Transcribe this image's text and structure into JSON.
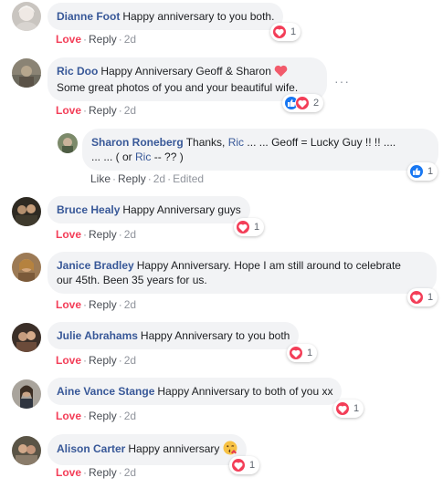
{
  "colors": {
    "author": "#385898",
    "love": "#f33e58",
    "like": "#1877f2",
    "bubble": "#f2f3f5"
  },
  "comments": [
    {
      "author": "Dianne Foot",
      "text": "Happy anniversary to you both.",
      "reaction_label": "Love",
      "reply_label": "Reply",
      "time": "2d",
      "reaction_count": "1",
      "reaction_icons": [
        "heart-icon"
      ]
    },
    {
      "author": "Ric Doo",
      "text_line1": "Happy Anniversary Geoff & Sharon",
      "text_line2": "Some great photos of you and your beautiful wife.",
      "reaction_label": "Love",
      "reply_label": "Reply",
      "time": "2d",
      "reaction_count": "2",
      "reaction_icons": [
        "like-icon",
        "heart-icon"
      ],
      "more_label": "···",
      "reply": {
        "author": "Sharon Roneberg",
        "text_a": "Thanks,",
        "mention_1": "Ric",
        "text_b": "... ... Geoff = Lucky Guy !! !! ....",
        "text_c": "... ... ( or",
        "mention_2": "Ric",
        "text_d": "-- ?? )",
        "reaction_label": "Like",
        "reply_label": "Reply",
        "time": "2d",
        "edited_label": "Edited",
        "reaction_count": "1",
        "reaction_icons": [
          "like-icon"
        ]
      }
    },
    {
      "author": "Bruce Healy",
      "text": "Happy Anniversary guys",
      "reaction_label": "Love",
      "reply_label": "Reply",
      "time": "2d",
      "reaction_count": "1",
      "reaction_icons": [
        "heart-icon"
      ]
    },
    {
      "author": "Janice Bradley",
      "text_line1": "Happy Anniversary. Hope I am still around to celebrate",
      "text_line2": "our 45th. Been 35 years for us.",
      "reaction_label": "Love",
      "reply_label": "Reply",
      "time": "2d",
      "reaction_count": "1",
      "reaction_icons": [
        "heart-icon"
      ]
    },
    {
      "author": "Julie Abrahams",
      "text": "Happy Anniversary to you both",
      "reaction_label": "Love",
      "reply_label": "Reply",
      "time": "2d",
      "reaction_count": "1",
      "reaction_icons": [
        "heart-icon"
      ]
    },
    {
      "author": "Aine Vance Stange",
      "text": "Happy Anniversary to both of you xx",
      "reaction_label": "Love",
      "reply_label": "Reply",
      "time": "2d",
      "reaction_count": "1",
      "reaction_icons": [
        "heart-icon"
      ]
    },
    {
      "author": "Alison Carter",
      "text": "Happy anniversary",
      "reaction_label": "Love",
      "reply_label": "Reply",
      "time": "2d",
      "reaction_count": "1",
      "reaction_icons": [
        "heart-icon"
      ]
    }
  ]
}
